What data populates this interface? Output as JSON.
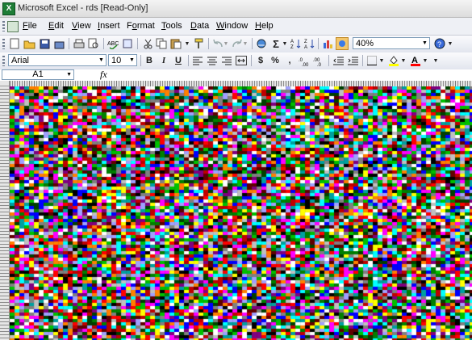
{
  "window": {
    "title": "Microsoft Excel - rds  [Read-Only]"
  },
  "menu": {
    "items": [
      {
        "label": "File",
        "key": "F"
      },
      {
        "label": "Edit",
        "key": "E"
      },
      {
        "label": "View",
        "key": "V"
      },
      {
        "label": "Insert",
        "key": "I"
      },
      {
        "label": "Format",
        "key": "o"
      },
      {
        "label": "Tools",
        "key": "T"
      },
      {
        "label": "Data",
        "key": "D"
      },
      {
        "label": "Window",
        "key": "W"
      },
      {
        "label": "Help",
        "key": "H"
      }
    ]
  },
  "standard_toolbar": {
    "zoom": "40%"
  },
  "formatting_toolbar": {
    "font": "Arial",
    "font_size": "10",
    "bold": "B",
    "italic": "I",
    "underline": "U",
    "currency": "$",
    "percent": "%",
    "comma": ","
  },
  "formula_bar": {
    "name_box": "A1",
    "fx": "fx",
    "formula": ""
  },
  "sheet": {
    "palette": [
      "#ff0000",
      "#00c000",
      "#0000ff",
      "#ffff00",
      "#ff00ff",
      "#00ffff",
      "#000000",
      "#ffffff",
      "#808080",
      "#c00000",
      "#008000",
      "#800080",
      "#ff8000",
      "#c0c0c0",
      "#004000",
      "#600000",
      "#a0a0ff",
      "#00a0a0"
    ]
  },
  "colors": {
    "titlebar": "#e6e6e6",
    "toolbar": "#eef0f5",
    "accent": "#1e7d36"
  }
}
